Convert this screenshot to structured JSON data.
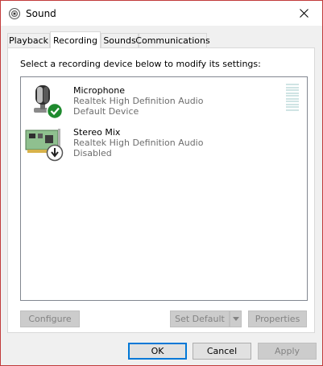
{
  "window": {
    "title": "Sound",
    "close_glyph": "✕"
  },
  "tabs": [
    {
      "label": "Playback",
      "active": false
    },
    {
      "label": "Recording",
      "active": true
    },
    {
      "label": "Sounds",
      "active": false
    },
    {
      "label": "Communications",
      "active": false
    }
  ],
  "panel": {
    "instruction": "Select a recording device below to modify its settings:"
  },
  "devices": [
    {
      "name": "Microphone",
      "driver": "Realtek High Definition Audio",
      "status": "Default Device",
      "icon": "microphone-icon",
      "badge": "green-check-badge-icon",
      "level_fraction": 0
    },
    {
      "name": "Stereo Mix",
      "driver": "Realtek High Definition Audio",
      "status": "Disabled",
      "icon": "sound-card-icon",
      "badge": "disabled-arrow-badge-icon"
    }
  ],
  "panel_buttons": {
    "configure": "Configure",
    "set_default": "Set Default",
    "properties": "Properties"
  },
  "dialog_buttons": {
    "ok": "OK",
    "cancel": "Cancel",
    "apply": "Apply"
  },
  "colors": {
    "accent": "#0078d7",
    "check_green": "#1e8a2e",
    "disabled_text": "#838383",
    "secondary_text": "#6d6d6d"
  }
}
